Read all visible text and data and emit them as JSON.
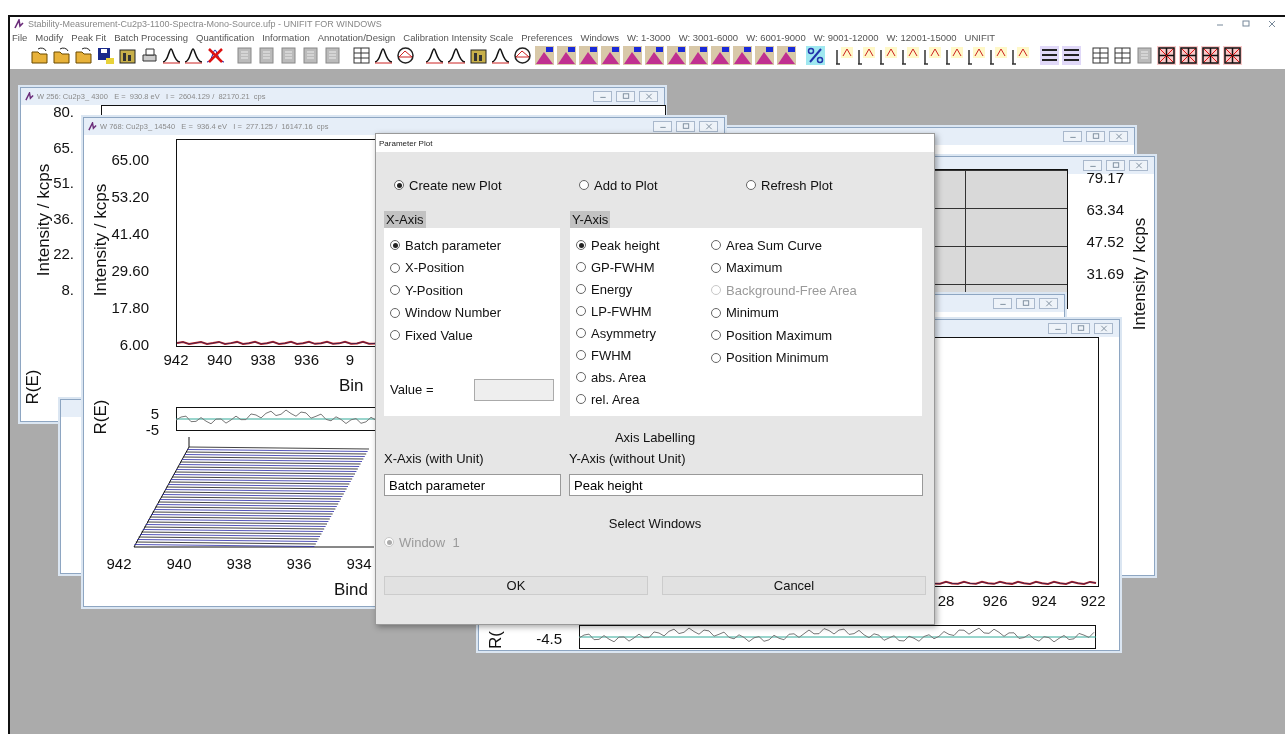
{
  "app": {
    "title": "Stability-Measurement-Cu2p3-1100-Spectra-Mono-Source.ufp - UNIFIT FOR WINDOWS",
    "menu": [
      "File",
      "Modify",
      "Peak Fit",
      "Batch Processing",
      "Quantification",
      "Information",
      "Annotation/Design",
      "Calibration Intensity Scale",
      "Preferences",
      "Windows",
      "W: 1-3000",
      "W: 3001-6000",
      "W: 6001-9000",
      "W: 9001-12000",
      "W: 12001-15000",
      "UNIFIT"
    ]
  },
  "windows": [
    {
      "kind": "left",
      "title": "W 256: Cu2p3_ 4300   E =  930.8 eV   I =  2604.129 /  82170.21  cps",
      "ylabel": "Intensity / kcps",
      "yticks": [
        "80.",
        "65.",
        "51.",
        "36.",
        "22.",
        "8."
      ],
      "residual_label": "R(E)"
    },
    {
      "kind": "blank"
    },
    {
      "kind": "left",
      "title": "W 768: Cu2p3_ 14540   E =  936.4 eV   I =  277.125 /  16147.16  cps",
      "ylabel": "Intensity / kcps",
      "yticks": [
        "65.00",
        "53.20",
        "41.40",
        "29.60",
        "17.80",
        "6.00"
      ],
      "xticks": [
        "942",
        "940",
        "938",
        "936",
        "9"
      ],
      "xlabel": "Bin",
      "residual_label": "R(E)",
      "residual_ticks": [
        "5",
        "-5"
      ],
      "waterfall_xticks": [
        "942",
        "940",
        "938",
        "936",
        "934"
      ],
      "waterfall_xlabel": "Bind"
    },
    {
      "kind": "blank"
    },
    {
      "kind": "right",
      "ylabel": "Intensity / kcps",
      "yticks": [
        "79.17",
        "63.34",
        "47.52",
        "31.69"
      ]
    },
    {
      "kind": "blank"
    },
    {
      "kind": "bottom",
      "xticks": [
        "28",
        "926",
        "924",
        "922"
      ],
      "residual_label": "R(",
      "residual_ticks": [
        "-4.5"
      ]
    }
  ],
  "dialog": {
    "title": "Parameter Plot",
    "modes": [
      {
        "label": "Create new Plot",
        "selected": true
      },
      {
        "label": "Add to Plot",
        "selected": false
      },
      {
        "label": "Refresh Plot",
        "selected": false
      }
    ],
    "x_axis": {
      "heading": "X-Axis",
      "options": [
        {
          "label": "Batch parameter",
          "selected": true
        },
        {
          "label": "X-Position",
          "selected": false
        },
        {
          "label": "Y-Position",
          "selected": false
        },
        {
          "label": "Window Number",
          "selected": false
        },
        {
          "label": "Fixed Value",
          "selected": false
        }
      ],
      "value_label": "Value ="
    },
    "y_axis": {
      "heading": "Y-Axis",
      "columns": [
        [
          {
            "label": "Peak height",
            "selected": true,
            "disabled": false
          },
          {
            "label": "GP-FWHM",
            "selected": false,
            "disabled": false
          },
          {
            "label": "Energy",
            "selected": false,
            "disabled": false
          },
          {
            "label": "LP-FWHM",
            "selected": false,
            "disabled": false
          },
          {
            "label": "Asymmetry",
            "selected": false,
            "disabled": false
          },
          {
            "label": "FWHM",
            "selected": false,
            "disabled": false
          },
          {
            "label": "abs. Area",
            "selected": false,
            "disabled": false
          },
          {
            "label": "rel. Area",
            "selected": false,
            "disabled": false
          }
        ],
        [
          {
            "label": "Area Sum Curve",
            "selected": false,
            "disabled": false
          },
          {
            "label": "Maximum",
            "selected": false,
            "disabled": false
          },
          {
            "label": "Background-Free Area",
            "selected": false,
            "disabled": true
          },
          {
            "label": "Minimum",
            "selected": false,
            "disabled": false
          },
          {
            "label": "Position Maximum",
            "selected": false,
            "disabled": false
          },
          {
            "label": "Position Minimum",
            "selected": false,
            "disabled": false
          }
        ]
      ]
    },
    "axis_labelling": {
      "heading": "Axis Labelling",
      "x_label": "X-Axis (with Unit)",
      "x_value": "Batch parameter",
      "y_label": "Y-Axis (without Unit)",
      "y_value": "Peak height"
    },
    "select_windows": {
      "heading": "Select Windows",
      "windows": [
        {
          "label": "Window  1",
          "selected": true,
          "disabled": true
        }
      ]
    },
    "buttons": [
      "OK",
      "Cancel"
    ]
  }
}
